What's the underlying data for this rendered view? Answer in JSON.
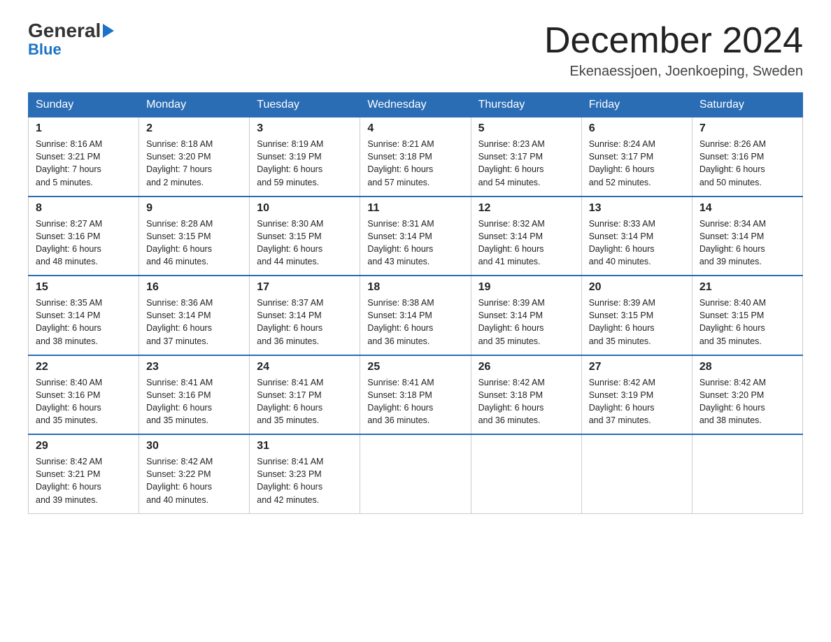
{
  "header": {
    "logo_general": "General",
    "logo_blue": "Blue",
    "month_year": "December 2024",
    "location": "Ekenaessjoen, Joenkoeping, Sweden"
  },
  "days_of_week": [
    "Sunday",
    "Monday",
    "Tuesday",
    "Wednesday",
    "Thursday",
    "Friday",
    "Saturday"
  ],
  "weeks": [
    [
      {
        "day": "1",
        "sunrise": "8:16 AM",
        "sunset": "3:21 PM",
        "daylight": "7 hours and 5 minutes."
      },
      {
        "day": "2",
        "sunrise": "8:18 AM",
        "sunset": "3:20 PM",
        "daylight": "7 hours and 2 minutes."
      },
      {
        "day": "3",
        "sunrise": "8:19 AM",
        "sunset": "3:19 PM",
        "daylight": "6 hours and 59 minutes."
      },
      {
        "day": "4",
        "sunrise": "8:21 AM",
        "sunset": "3:18 PM",
        "daylight": "6 hours and 57 minutes."
      },
      {
        "day": "5",
        "sunrise": "8:23 AM",
        "sunset": "3:17 PM",
        "daylight": "6 hours and 54 minutes."
      },
      {
        "day": "6",
        "sunrise": "8:24 AM",
        "sunset": "3:17 PM",
        "daylight": "6 hours and 52 minutes."
      },
      {
        "day": "7",
        "sunrise": "8:26 AM",
        "sunset": "3:16 PM",
        "daylight": "6 hours and 50 minutes."
      }
    ],
    [
      {
        "day": "8",
        "sunrise": "8:27 AM",
        "sunset": "3:16 PM",
        "daylight": "6 hours and 48 minutes."
      },
      {
        "day": "9",
        "sunrise": "8:28 AM",
        "sunset": "3:15 PM",
        "daylight": "6 hours and 46 minutes."
      },
      {
        "day": "10",
        "sunrise": "8:30 AM",
        "sunset": "3:15 PM",
        "daylight": "6 hours and 44 minutes."
      },
      {
        "day": "11",
        "sunrise": "8:31 AM",
        "sunset": "3:14 PM",
        "daylight": "6 hours and 43 minutes."
      },
      {
        "day": "12",
        "sunrise": "8:32 AM",
        "sunset": "3:14 PM",
        "daylight": "6 hours and 41 minutes."
      },
      {
        "day": "13",
        "sunrise": "8:33 AM",
        "sunset": "3:14 PM",
        "daylight": "6 hours and 40 minutes."
      },
      {
        "day": "14",
        "sunrise": "8:34 AM",
        "sunset": "3:14 PM",
        "daylight": "6 hours and 39 minutes."
      }
    ],
    [
      {
        "day": "15",
        "sunrise": "8:35 AM",
        "sunset": "3:14 PM",
        "daylight": "6 hours and 38 minutes."
      },
      {
        "day": "16",
        "sunrise": "8:36 AM",
        "sunset": "3:14 PM",
        "daylight": "6 hours and 37 minutes."
      },
      {
        "day": "17",
        "sunrise": "8:37 AM",
        "sunset": "3:14 PM",
        "daylight": "6 hours and 36 minutes."
      },
      {
        "day": "18",
        "sunrise": "8:38 AM",
        "sunset": "3:14 PM",
        "daylight": "6 hours and 36 minutes."
      },
      {
        "day": "19",
        "sunrise": "8:39 AM",
        "sunset": "3:14 PM",
        "daylight": "6 hours and 35 minutes."
      },
      {
        "day": "20",
        "sunrise": "8:39 AM",
        "sunset": "3:15 PM",
        "daylight": "6 hours and 35 minutes."
      },
      {
        "day": "21",
        "sunrise": "8:40 AM",
        "sunset": "3:15 PM",
        "daylight": "6 hours and 35 minutes."
      }
    ],
    [
      {
        "day": "22",
        "sunrise": "8:40 AM",
        "sunset": "3:16 PM",
        "daylight": "6 hours and 35 minutes."
      },
      {
        "day": "23",
        "sunrise": "8:41 AM",
        "sunset": "3:16 PM",
        "daylight": "6 hours and 35 minutes."
      },
      {
        "day": "24",
        "sunrise": "8:41 AM",
        "sunset": "3:17 PM",
        "daylight": "6 hours and 35 minutes."
      },
      {
        "day": "25",
        "sunrise": "8:41 AM",
        "sunset": "3:18 PM",
        "daylight": "6 hours and 36 minutes."
      },
      {
        "day": "26",
        "sunrise": "8:42 AM",
        "sunset": "3:18 PM",
        "daylight": "6 hours and 36 minutes."
      },
      {
        "day": "27",
        "sunrise": "8:42 AM",
        "sunset": "3:19 PM",
        "daylight": "6 hours and 37 minutes."
      },
      {
        "day": "28",
        "sunrise": "8:42 AM",
        "sunset": "3:20 PM",
        "daylight": "6 hours and 38 minutes."
      }
    ],
    [
      {
        "day": "29",
        "sunrise": "8:42 AM",
        "sunset": "3:21 PM",
        "daylight": "6 hours and 39 minutes."
      },
      {
        "day": "30",
        "sunrise": "8:42 AM",
        "sunset": "3:22 PM",
        "daylight": "6 hours and 40 minutes."
      },
      {
        "day": "31",
        "sunrise": "8:41 AM",
        "sunset": "3:23 PM",
        "daylight": "6 hours and 42 minutes."
      },
      null,
      null,
      null,
      null
    ]
  ],
  "labels": {
    "sunrise": "Sunrise:",
    "sunset": "Sunset:",
    "daylight": "Daylight:"
  }
}
